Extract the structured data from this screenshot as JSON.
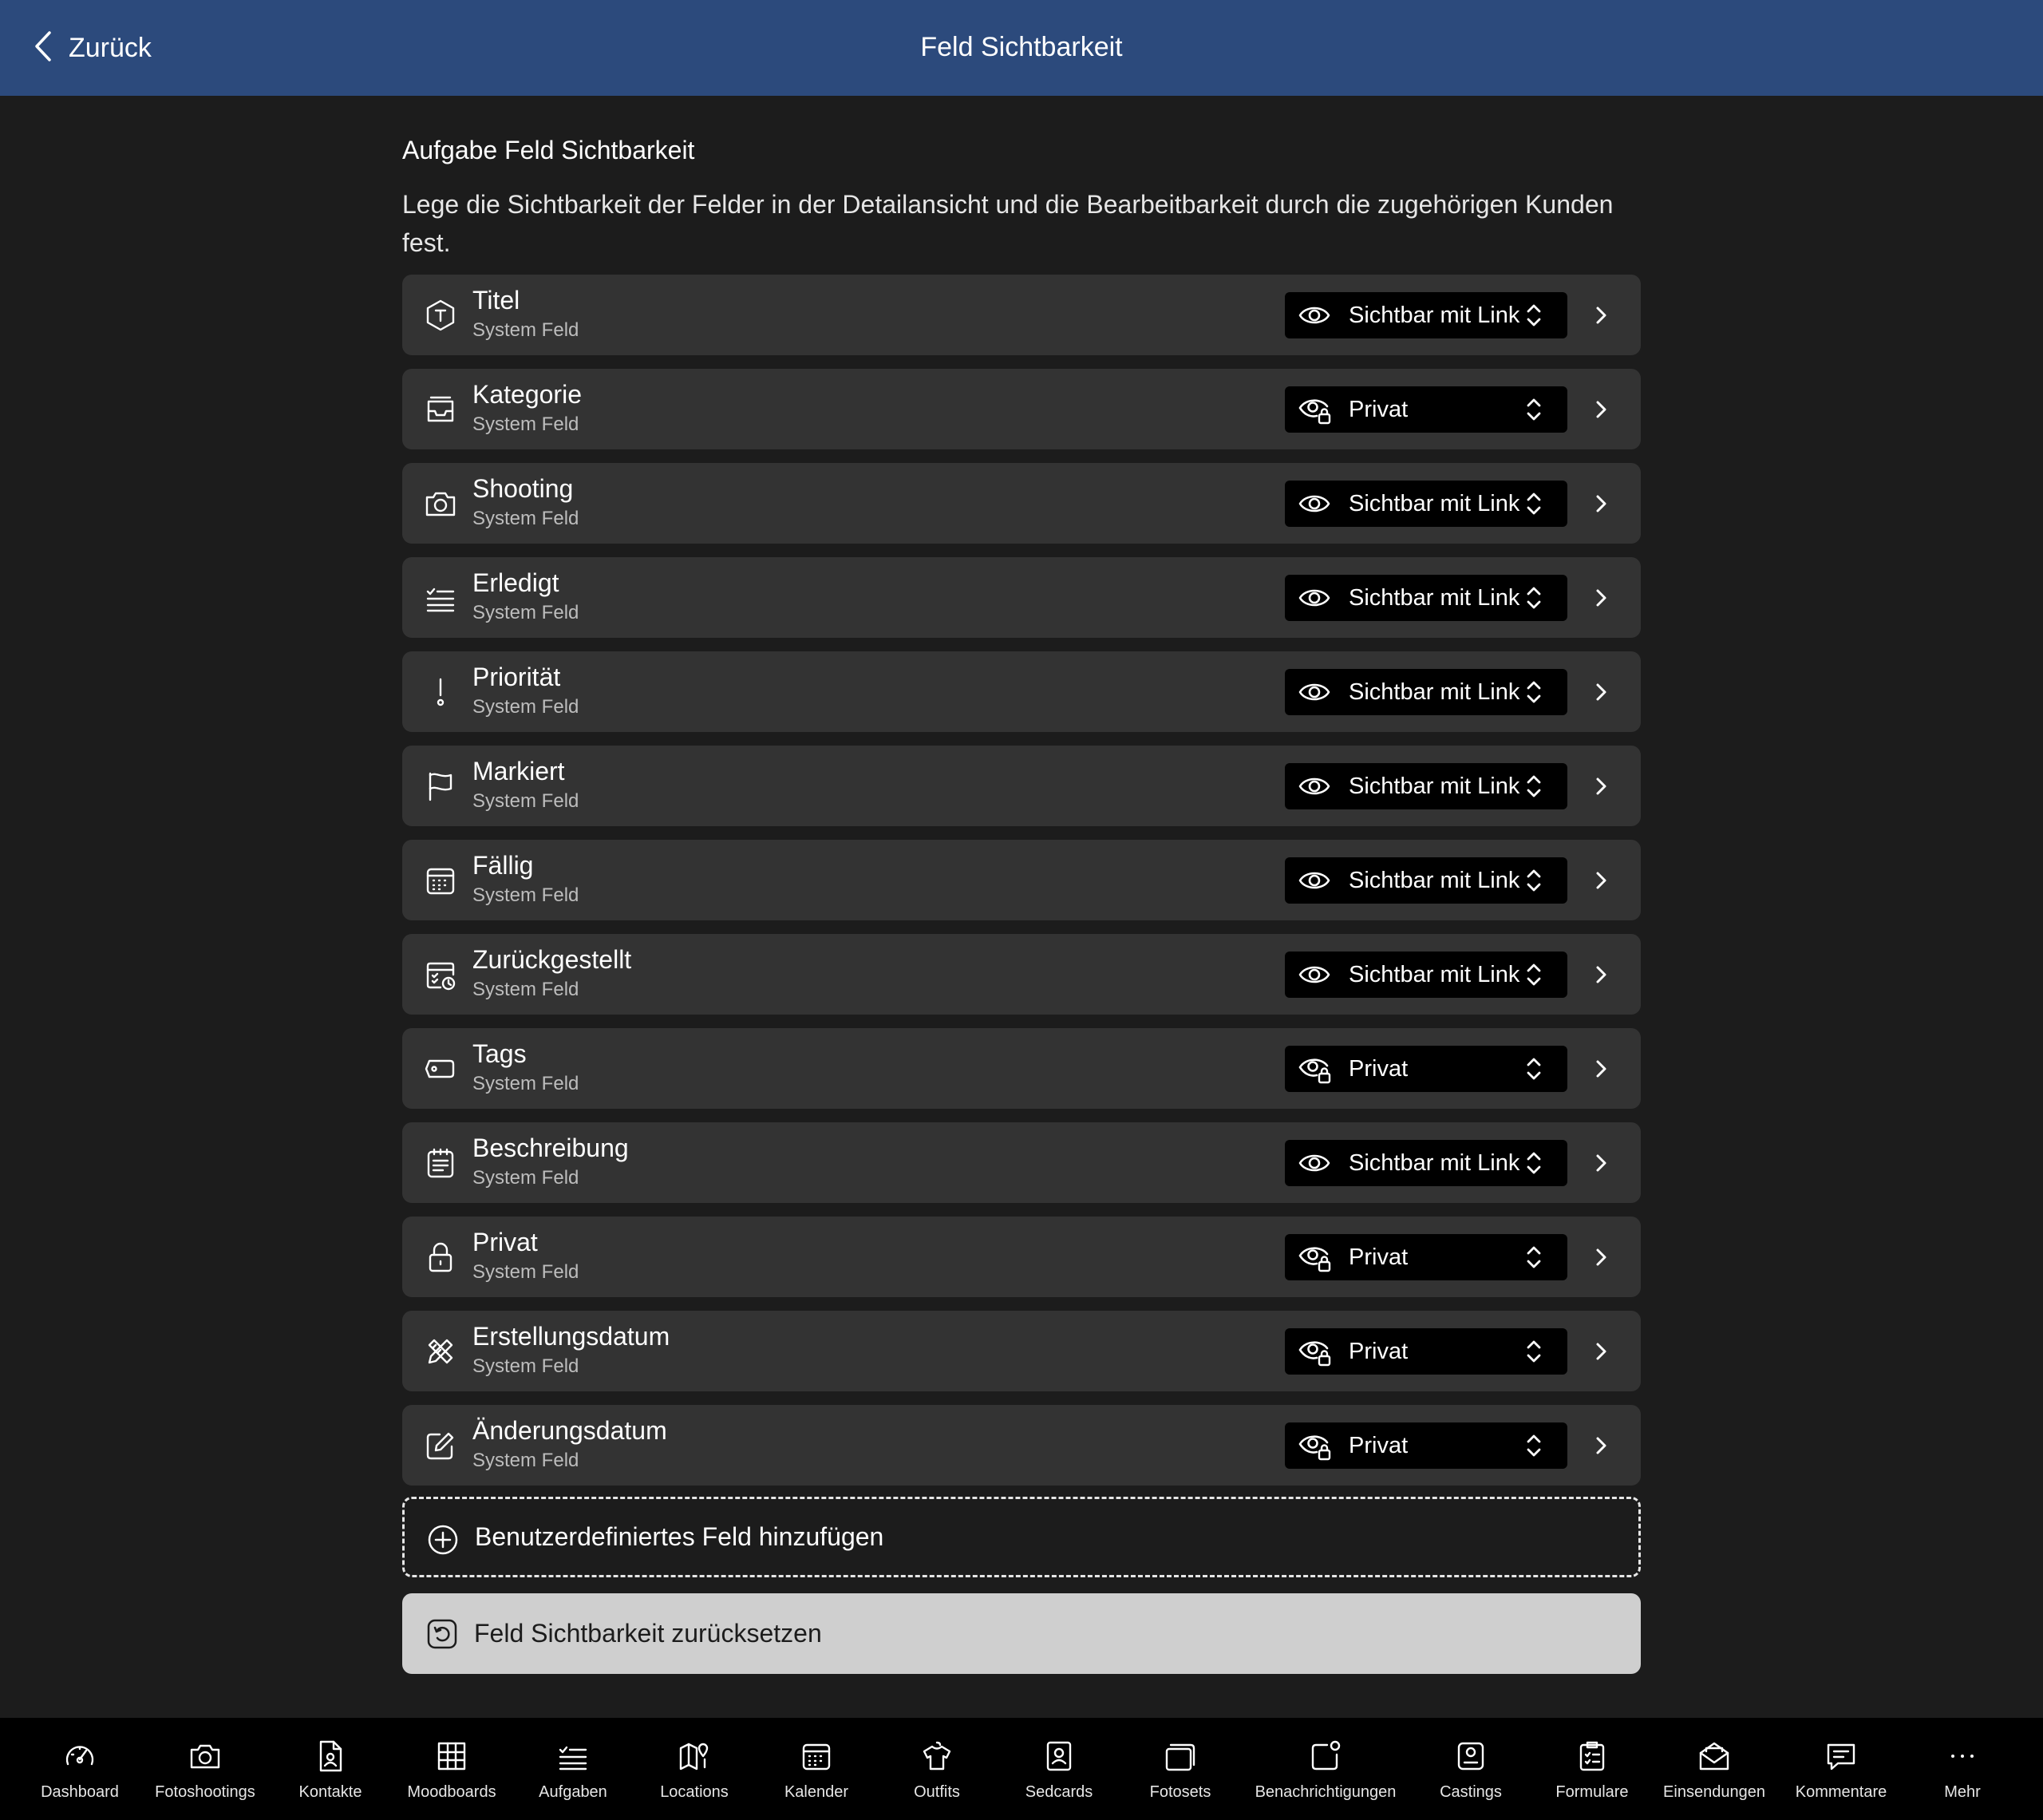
{
  "header": {
    "back_label": "Zurück",
    "title": "Feld Sichtbarkeit"
  },
  "section": {
    "title": "Aufgabe Feld Sichtbarkeit",
    "description": "Lege die Sichtbarkeit der Felder in der Detailansicht und die Bearbeitbarkeit durch die zugehörigen Kunden fest."
  },
  "fields": [
    {
      "title": "Titel",
      "subtitle": "System Feld",
      "icon": "title-hexagon-icon",
      "visibility": "Sichtbar mit Link"
    },
    {
      "title": "Kategorie",
      "subtitle": "System Feld",
      "icon": "tray-icon",
      "visibility": "Privat"
    },
    {
      "title": "Shooting",
      "subtitle": "System Feld",
      "icon": "camera-icon",
      "visibility": "Sichtbar mit Link"
    },
    {
      "title": "Erledigt",
      "subtitle": "System Feld",
      "icon": "checklist-icon",
      "visibility": "Sichtbar mit Link"
    },
    {
      "title": "Priorität",
      "subtitle": "System Feld",
      "icon": "exclamation-icon",
      "visibility": "Sichtbar mit Link"
    },
    {
      "title": "Markiert",
      "subtitle": "System Feld",
      "icon": "flag-icon",
      "visibility": "Sichtbar mit Link"
    },
    {
      "title": "Fällig",
      "subtitle": "System Feld",
      "icon": "calendar-icon",
      "visibility": "Sichtbar mit Link"
    },
    {
      "title": "Zurückgestellt",
      "subtitle": "System Feld",
      "icon": "calendar-clock-icon",
      "visibility": "Sichtbar mit Link"
    },
    {
      "title": "Tags",
      "subtitle": "System Feld",
      "icon": "tag-icon",
      "visibility": "Privat"
    },
    {
      "title": "Beschreibung",
      "subtitle": "System Feld",
      "icon": "notes-icon",
      "visibility": "Sichtbar mit Link"
    },
    {
      "title": "Privat",
      "subtitle": "System Feld",
      "icon": "lock-icon",
      "visibility": "Privat"
    },
    {
      "title": "Erstellungsdatum",
      "subtitle": "System Feld",
      "icon": "pencil-ruler-icon",
      "visibility": "Privat"
    },
    {
      "title": "Änderungsdatum",
      "subtitle": "System Feld",
      "icon": "edit-icon",
      "visibility": "Privat"
    }
  ],
  "actions": {
    "add_custom_field": "Benutzerdefiniertes Feld hinzufügen",
    "reset_visibility": "Feld Sichtbarkeit zurücksetzen"
  },
  "tabbar": [
    {
      "label": "Dashboard",
      "icon": "gauge-icon"
    },
    {
      "label": "Fotoshootings",
      "icon": "camera-icon"
    },
    {
      "label": "Kontakte",
      "icon": "contact-file-icon"
    },
    {
      "label": "Moodboards",
      "icon": "grid-icon"
    },
    {
      "label": "Aufgaben",
      "icon": "checklist-icon"
    },
    {
      "label": "Locations",
      "icon": "map-pin-icon"
    },
    {
      "label": "Kalender",
      "icon": "calendar-icon"
    },
    {
      "label": "Outfits",
      "icon": "shirt-icon"
    },
    {
      "label": "Sedcards",
      "icon": "card-portrait-icon"
    },
    {
      "label": "Fotosets",
      "icon": "photo-stack-icon"
    },
    {
      "label": "Benachrichtigungen",
      "icon": "notification-icon"
    },
    {
      "label": "Castings",
      "icon": "casting-icon"
    },
    {
      "label": "Formulare",
      "icon": "clipboard-icon"
    },
    {
      "label": "Einsendungen",
      "icon": "envelope-icon"
    },
    {
      "label": "Kommentare",
      "icon": "comment-icon"
    },
    {
      "label": "Mehr",
      "icon": "more-icon"
    }
  ]
}
